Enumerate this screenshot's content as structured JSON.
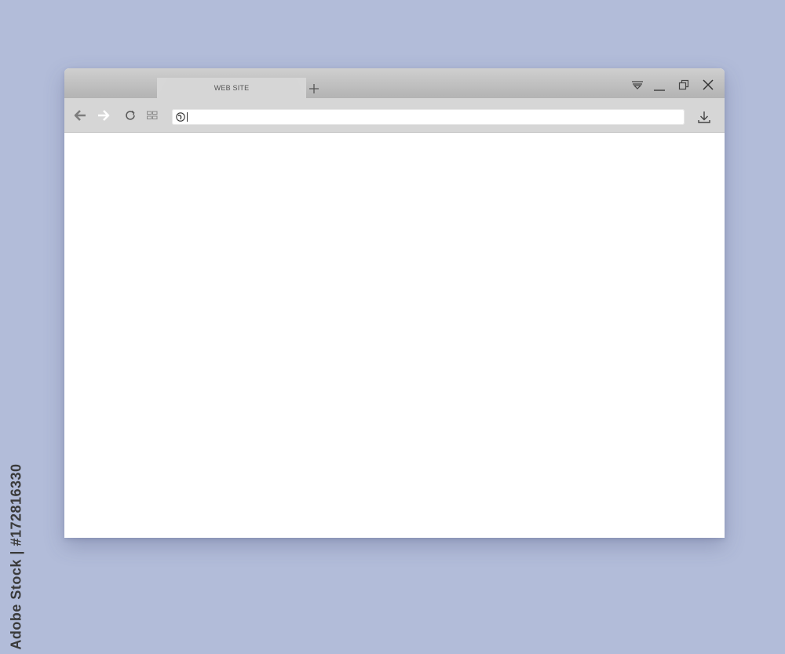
{
  "browser": {
    "tab": {
      "title": "WEB SITE"
    },
    "new_tab_icon": "plus-icon",
    "window_controls": [
      "tab-menu-icon",
      "minimize-icon",
      "restore-icon",
      "close-icon"
    ],
    "toolbar": {
      "back_icon": "arrow-left-icon",
      "forward_icon": "arrow-right-icon",
      "reload_icon": "reload-icon",
      "apps_icon": "grid-icon",
      "download_icon": "download-icon"
    },
    "address_bar": {
      "value": "",
      "placeholder": ""
    }
  },
  "watermark": {
    "stock_id": "Adobe Stock | #172816330"
  },
  "colors": {
    "background": "#b2bcd9",
    "titlebar": "#c2c2c2",
    "toolbar": "#d6d6d6",
    "content": "#ffffff"
  }
}
